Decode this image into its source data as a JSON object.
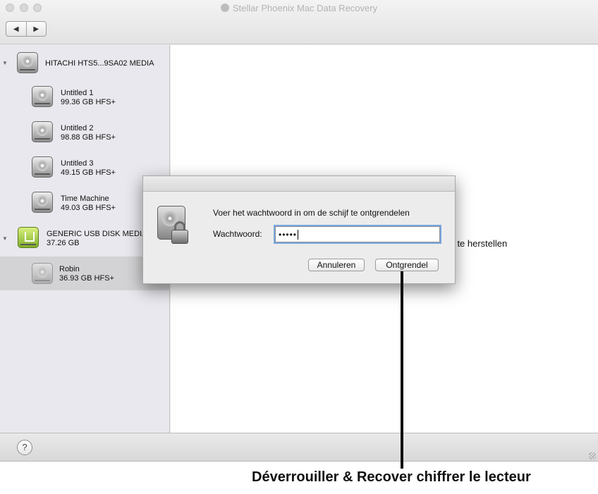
{
  "window": {
    "title": "Stellar Phoenix Mac Data Recovery",
    "nav": {
      "back_icon": "◀",
      "forward_icon": "▶"
    }
  },
  "sidebar": {
    "drives": [
      {
        "name": "HITACHI HTS5...9SA02 MEDIA",
        "icon": "hard-drive-icon",
        "volumes": [
          {
            "name": "Untitled 1",
            "size": "99.36 GB HFS+"
          },
          {
            "name": "Untitled 2",
            "size": "98.88 GB HFS+"
          },
          {
            "name": "Untitled 3",
            "size": "49.15 GB HFS+"
          },
          {
            "name": "Time Machine",
            "size": "49.03 GB HFS+"
          }
        ]
      },
      {
        "name": "GENERIC USB DISK MEDIA",
        "size": "37.26 GB",
        "icon": "usb-drive-icon",
        "volumes": [
          {
            "name": "Robin",
            "size": "36.93 GB HFS+",
            "selected": true
          }
        ]
      }
    ]
  },
  "content": {
    "background_text": "m te herstellen"
  },
  "dialog": {
    "message": "Voer het wachtwoord in om de schijf te ontgrendelen",
    "password_label": "Wachtwoord:",
    "password_value": "•••••",
    "cancel_label": "Annuleren",
    "unlock_label": "Ontgrendel"
  },
  "statusbar": {
    "help_label": "?"
  },
  "caption": "Déverrouiller & Recover chiffrer le lecteur",
  "colors": {
    "sidebar_bg": "#e8e8ee",
    "selected_row": "#d3d3d5",
    "focus_ring": "#7aa7e0",
    "usb_green": "#a6cf3c"
  }
}
